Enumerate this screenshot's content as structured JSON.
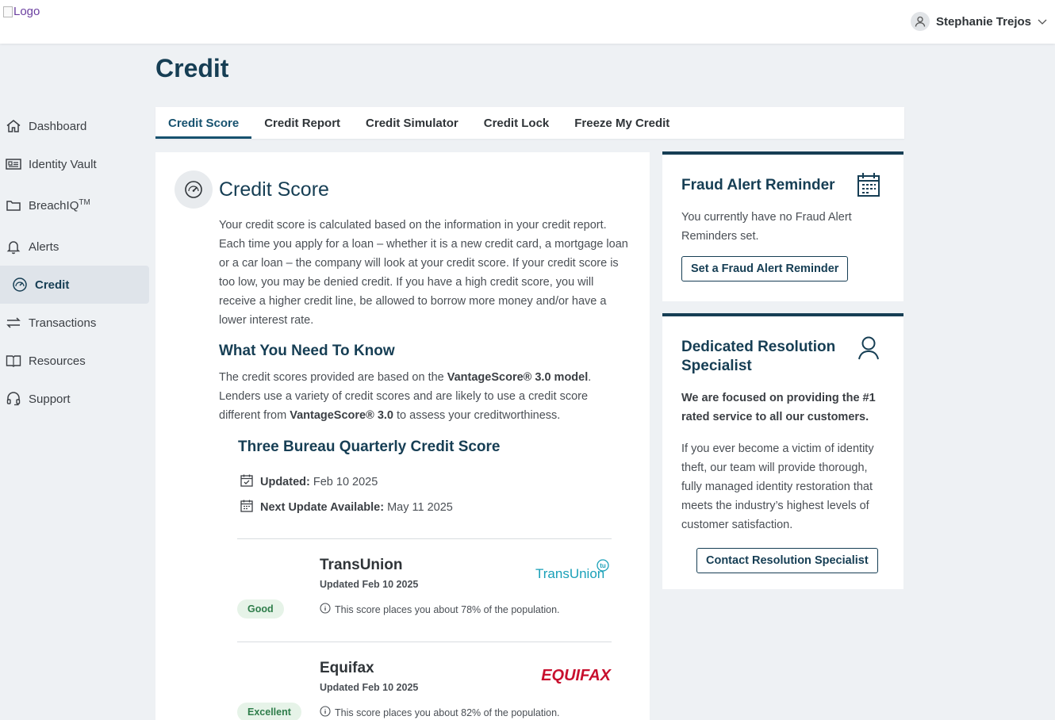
{
  "header": {
    "logo_alt": "Logo",
    "user_name": "Stephanie Trejos"
  },
  "sidebar": {
    "items": [
      {
        "label": "Dashboard",
        "icon": "home-icon"
      },
      {
        "label": "Identity Vault",
        "icon": "id-card-icon"
      },
      {
        "label": "BreachIQ",
        "sup": "TM",
        "icon": "folder-icon"
      },
      {
        "label": "Alerts",
        "icon": "bell-icon"
      },
      {
        "label": "Credit",
        "icon": "gauge-icon",
        "active": true
      },
      {
        "label": "Transactions",
        "icon": "arrows-icon"
      },
      {
        "label": "Resources",
        "icon": "book-icon"
      },
      {
        "label": "Support",
        "icon": "headset-icon"
      }
    ]
  },
  "page": {
    "title": "Credit"
  },
  "tabs": [
    {
      "label": "Credit Score",
      "active": true
    },
    {
      "label": "Credit Report"
    },
    {
      "label": "Credit Simulator"
    },
    {
      "label": "Credit Lock"
    },
    {
      "label": "Freeze My Credit"
    }
  ],
  "credit_score": {
    "title": "Credit Score",
    "description": "Your credit score is calculated based on the information in your credit report. Each time you apply for a loan – whether it is a new credit card, a mortgage loan or a car loan – the company will look at your credit score. If your credit score is too low, you may be denied credit. If you have a high credit score, you will receive a higher credit line, be allowed to borrow more money and/or have a lower interest rate.",
    "wytk_title": "What You Need To Know",
    "wytk_p1": "The credit scores provided are based on the ",
    "wytk_b1": "VantageScore® 3.0 model",
    "wytk_p2": ". Lenders use a variety of credit scores and are likely to use a credit score different from ",
    "wytk_b2": "VantageScore® 3.0",
    "wytk_p3": " to assess your creditworthiness.",
    "three_bureau_title": "Three Bureau Quarterly Credit Score",
    "updated_label": "Updated:",
    "updated_value": "Feb 10 2025",
    "next_label": "Next Update Available:",
    "next_value": "May 11 2025"
  },
  "bureaus": [
    {
      "name": "TransUnion",
      "updated": "Updated Feb 10 2025",
      "rating": "Good",
      "population": "This score places you about 78% of the population.",
      "logo_text": "TransUnion",
      "logo_badge": "tu"
    },
    {
      "name": "Equifax",
      "updated": "Updated Feb 10 2025",
      "rating": "Excellent",
      "population": "This score places you about 82% of the population.",
      "logo_text": "EQUIFAX"
    }
  ],
  "fraud_alert": {
    "title": "Fraud Alert Reminder",
    "text": "You currently have no Fraud Alert Reminders set.",
    "button": "Set a Fraud Alert Reminder"
  },
  "resolution": {
    "title": "Dedicated Resolution Specialist",
    "bold_text": "We are focused on providing the #1 rated service to all our customers.",
    "text": "If you ever become a victim of identity theft, our team will provide thorough, fully managed identity restoration that meets the industry’s highest levels of customer satisfaction.",
    "button": "Contact Resolution Specialist"
  },
  "colors": {
    "brand": "#163e54",
    "good": "#2e7d4a",
    "transunion": "#1aa0b8",
    "equifax": "#c8102e"
  }
}
